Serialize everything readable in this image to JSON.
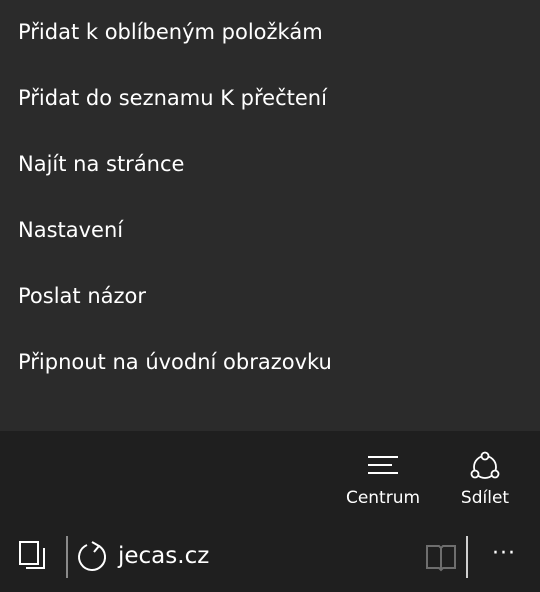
{
  "menu": {
    "items": [
      {
        "label": "Přidat k oblíbeným položkám"
      },
      {
        "label": "Přidat do seznamu K přečtení"
      },
      {
        "label": "Najít na stránce"
      },
      {
        "label": "Nastavení"
      },
      {
        "label": "Poslat názor"
      },
      {
        "label": "Připnout na úvodní obrazovku"
      }
    ]
  },
  "actions": {
    "hub": {
      "label": "Centrum",
      "icon": "hub-lines-icon"
    },
    "share": {
      "label": "Sdílet",
      "icon": "share-icon"
    }
  },
  "addressbar": {
    "url": "jecas.cz",
    "tabs_icon": "tabs-icon",
    "refresh_icon": "refresh-icon",
    "reading_view_icon": "book-icon",
    "more_label": "···"
  },
  "colors": {
    "menu_bg": "#2b2b2b",
    "bar_bg": "#1f1f1f",
    "text": "#ffffff",
    "disabled_icon": "#6e6e6e"
  }
}
